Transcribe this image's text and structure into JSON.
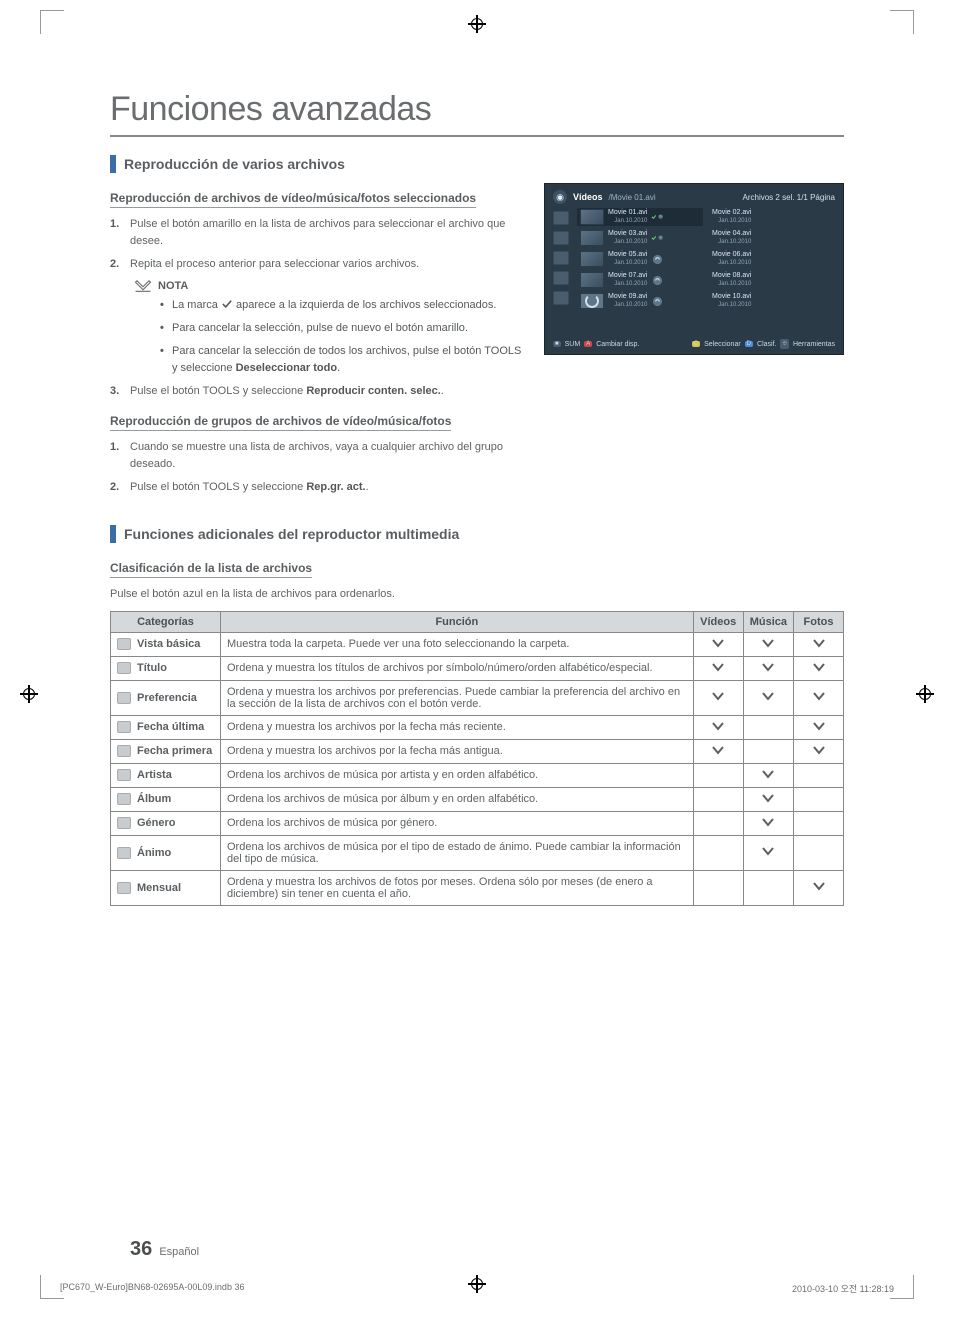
{
  "page": {
    "title": "Funciones avanzadas",
    "section1": "Reproducción de varios archivos",
    "sub1": "Reproducción de archivos de vídeo/música/fotos seleccionados",
    "steps1": [
      "Pulse el botón amarillo en la lista de archivos para seleccionar el archivo que desee.",
      "Repita el proceso anterior para seleccionar varios archivos."
    ],
    "note_label": "NOTA",
    "notes1": [
      "La marca   aparece a la izquierda de los archivos seleccionados.",
      "Para cancelar la selección, pulse de nuevo el botón amarillo.",
      "Para cancelar la selección de todos los archivos, pulse el botón TOOLS y seleccione Deseleccionar todo."
    ],
    "step1_3_pre": "Pulse el botón TOOLS y seleccione ",
    "step1_3_bold": "Reproducir conten. selec.",
    "step1_3_post": ".",
    "sub2": "Reproducción de grupos de archivos de vídeo/música/fotos",
    "steps2": [
      "Cuando se muestre una lista de archivos, vaya a cualquier archivo del grupo deseado.",
      "Pulse el botón TOOLS y seleccione Rep.gr. act.."
    ],
    "section2": "Funciones adicionales del reproductor multimedia",
    "sub3": "Clasificación de la lista de archivos",
    "sub3_desc": "Pulse el botón azul en la lista de archivos para ordenarlos.",
    "table": {
      "headers": [
        "Categorías",
        "Función",
        "Vídeos",
        "Música",
        "Fotos"
      ],
      "rows": [
        {
          "cat": "Vista básica",
          "desc": "Muestra toda la carpeta. Puede ver una foto seleccionando la carpeta.",
          "v": true,
          "m": true,
          "f": true
        },
        {
          "cat": "Título",
          "desc": "Ordena y muestra los títulos de archivos por símbolo/número/orden alfabético/especial.",
          "v": true,
          "m": true,
          "f": true
        },
        {
          "cat": "Preferencia",
          "desc": "Ordena y muestra los archivos por preferencias. Puede cambiar la preferencia del archivo en la sección de la lista de archivos con el botón verde.",
          "v": true,
          "m": true,
          "f": true
        },
        {
          "cat": "Fecha última",
          "desc": "Ordena y muestra los archivos por la fecha más reciente.",
          "v": true,
          "m": false,
          "f": true
        },
        {
          "cat": "Fecha primera",
          "desc": "Ordena y muestra los archivos por la fecha más antigua.",
          "v": true,
          "m": false,
          "f": true
        },
        {
          "cat": "Artista",
          "desc": "Ordena los archivos de música por artista y en orden alfabético.",
          "v": false,
          "m": true,
          "f": false
        },
        {
          "cat": "Álbum",
          "desc": "Ordena los archivos de música por álbum y en orden alfabético.",
          "v": false,
          "m": true,
          "f": false
        },
        {
          "cat": "Género",
          "desc": "Ordena los archivos de música por género.",
          "v": false,
          "m": true,
          "f": false
        },
        {
          "cat": "Ánimo",
          "desc": "Ordena los archivos de música por el tipo de estado de ánimo. Puede cambiar la información del tipo de música.",
          "v": false,
          "m": true,
          "f": false
        },
        {
          "cat": "Mensual",
          "desc": "Ordena y muestra los archivos de fotos por meses. Ordena sólo por meses (de enero a diciembre) sin tener en cuenta el año.",
          "v": false,
          "m": false,
          "f": true
        }
      ]
    }
  },
  "tv": {
    "title": "Vídeos",
    "path": "/Movie 01.avi",
    "top_right": "Archivos 2 sel.    1/1 Página",
    "files": [
      {
        "l": "Movie 01.avi",
        "r": "Movie 02.avi",
        "d": "Jan.10.2010",
        "chk": true
      },
      {
        "l": "Movie 03.avi",
        "r": "Movie 04.avi",
        "d": "Jan.10.2010",
        "chk": true
      },
      {
        "l": "Movie 05.avi",
        "r": "Movie 06.avi",
        "d": "Jan.10.2010",
        "chk": false
      },
      {
        "l": "Movie 07.avi",
        "r": "Movie 08.avi",
        "d": "Jan.10.2010",
        "chk": false
      },
      {
        "l": "Movie 09.avi",
        "r": "Movie 10.avi",
        "d": "Jan.10.2010",
        "chk": false,
        "load": true
      }
    ],
    "foot": {
      "sum": "SUM",
      "a": "Cambiar disp.",
      "sel": "Seleccionar",
      "clasif": "Clasif.",
      "tools": "Herramientas"
    }
  },
  "footer": {
    "num": "36",
    "lang": "Español",
    "file": "[PC670_W-Euro]BN68-02695A-00L09.indb   36",
    "date": "2010-03-10   오전 11:28:19"
  }
}
